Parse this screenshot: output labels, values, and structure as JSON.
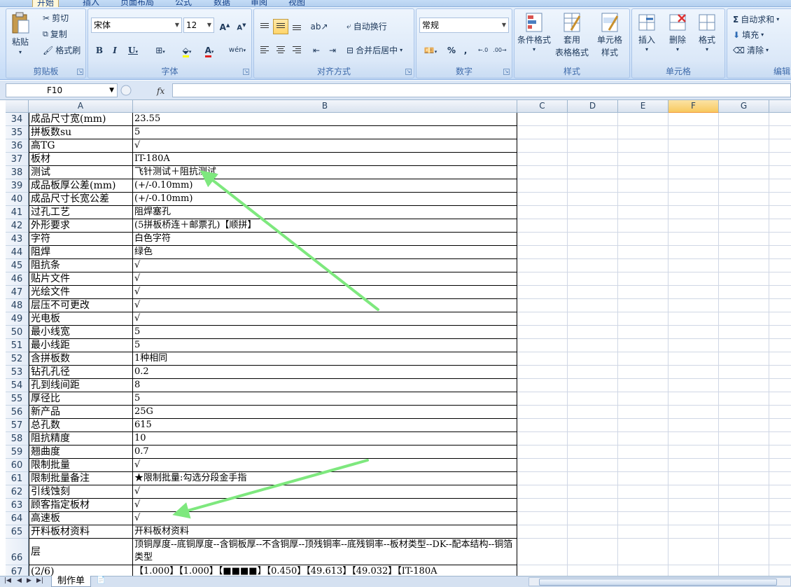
{
  "ribbon": {
    "tabs": [
      "开始",
      "插入",
      "页面布局",
      "公式",
      "数据",
      "审阅",
      "视图"
    ],
    "clipboard": {
      "paste": "粘贴",
      "cut": "剪切",
      "copy": "复制",
      "format_painter": "格式刷",
      "label": "剪贴板"
    },
    "font": {
      "name": "宋体",
      "size": "12",
      "bold": "B",
      "italic": "I",
      "underline": "U",
      "grow": "A",
      "shrink": "A",
      "label": "字体"
    },
    "alignment": {
      "wrap": "自动换行",
      "merge": "合并后居中",
      "label": "对齐方式"
    },
    "number": {
      "format": "常规",
      "percent": "%",
      "comma": ",",
      "label": "数字"
    },
    "styles": {
      "conditional": "条件格式",
      "table_line1": "套用",
      "table_line2": "表格格式",
      "cell_line1": "单元格",
      "cell_line2": "样式",
      "label": "样式"
    },
    "cells": {
      "insert": "插入",
      "delete": "删除",
      "format": "格式",
      "label": "单元格"
    },
    "editing": {
      "autosum": "自动求和",
      "fill": "填充",
      "clear": "清除",
      "label": "编辑"
    }
  },
  "formula_bar": {
    "name_box": "F10",
    "fx": "fx",
    "value": ""
  },
  "columns": [
    "A",
    "B",
    "C",
    "D",
    "E",
    "F",
    "G"
  ],
  "selected_column": "F",
  "rows": [
    {
      "n": "34",
      "a": "成品尺寸宽(mm)",
      "b": "23.55"
    },
    {
      "n": "35",
      "a": "拼板数su",
      "b": "5"
    },
    {
      "n": "36",
      "a": "高TG",
      "b": "√"
    },
    {
      "n": "37",
      "a": "板材",
      "b": "IT-180A"
    },
    {
      "n": "38",
      "a": "测试",
      "b": "飞针测试＋阻抗测试"
    },
    {
      "n": "39",
      "a": "成品板厚公差(mm)",
      "b": "(+/-0.10mm)"
    },
    {
      "n": "40",
      "a": "成品尺寸长宽公差",
      "b": "(+/-0.10mm)"
    },
    {
      "n": "41",
      "a": "过孔工艺",
      "b": "阻焊塞孔"
    },
    {
      "n": "42",
      "a": "外形要求",
      "b": "(5拼板桥连＋邮票孔)【顺拼】"
    },
    {
      "n": "43",
      "a": "字符",
      "b": "白色字符"
    },
    {
      "n": "44",
      "a": "阻焊",
      "b": "绿色"
    },
    {
      "n": "45",
      "a": "阻抗条",
      "b": "√"
    },
    {
      "n": "46",
      "a": "贴片文件",
      "b": "√"
    },
    {
      "n": "47",
      "a": "光绘文件",
      "b": "√"
    },
    {
      "n": "48",
      "a": "层压不可更改",
      "b": "√"
    },
    {
      "n": "49",
      "a": "光电板",
      "b": "√"
    },
    {
      "n": "50",
      "a": "最小线宽",
      "b": "5"
    },
    {
      "n": "51",
      "a": "最小线距",
      "b": "5"
    },
    {
      "n": "52",
      "a": "含拼板数",
      "b": "1种相同"
    },
    {
      "n": "53",
      "a": "钻孔孔径",
      "b": "0.2"
    },
    {
      "n": "54",
      "a": "孔到线间距",
      "b": "8"
    },
    {
      "n": "55",
      "a": "厚径比",
      "b": "5"
    },
    {
      "n": "56",
      "a": "新产品",
      "b": "25G"
    },
    {
      "n": "57",
      "a": "总孔数",
      "b": "615"
    },
    {
      "n": "58",
      "a": "阻抗精度",
      "b": "10"
    },
    {
      "n": "59",
      "a": "翘曲度",
      "b": "0.7"
    },
    {
      "n": "60",
      "a": "限制批量",
      "b": "√"
    },
    {
      "n": "61",
      "a": "限制批量备注",
      "b": "★限制批量:勾选分段金手指"
    },
    {
      "n": "62",
      "a": "引线蚀刻",
      "b": "√"
    },
    {
      "n": "63",
      "a": "顾客指定板材",
      "b": "√"
    },
    {
      "n": "64",
      "a": "高速板",
      "b": "√"
    },
    {
      "n": "65",
      "a": "开料板材资料",
      "b": "开料板材资料"
    },
    {
      "n": "66",
      "a": "层",
      "b": "顶铜厚度--底铜厚度--含铜板厚--不含铜厚--顶残铜率--底残铜率--板材类型--DK--配本结构--铜箔类型",
      "tall": true
    },
    {
      "n": "67",
      "a": "(2/6)",
      "b": "【1.000】【1.000】【■■■■】【0.450】【49.613】【49.032】【IT-180A"
    }
  ],
  "sheet_tabs": [
    "制作单"
  ],
  "annotation_color": "#7ee87e"
}
